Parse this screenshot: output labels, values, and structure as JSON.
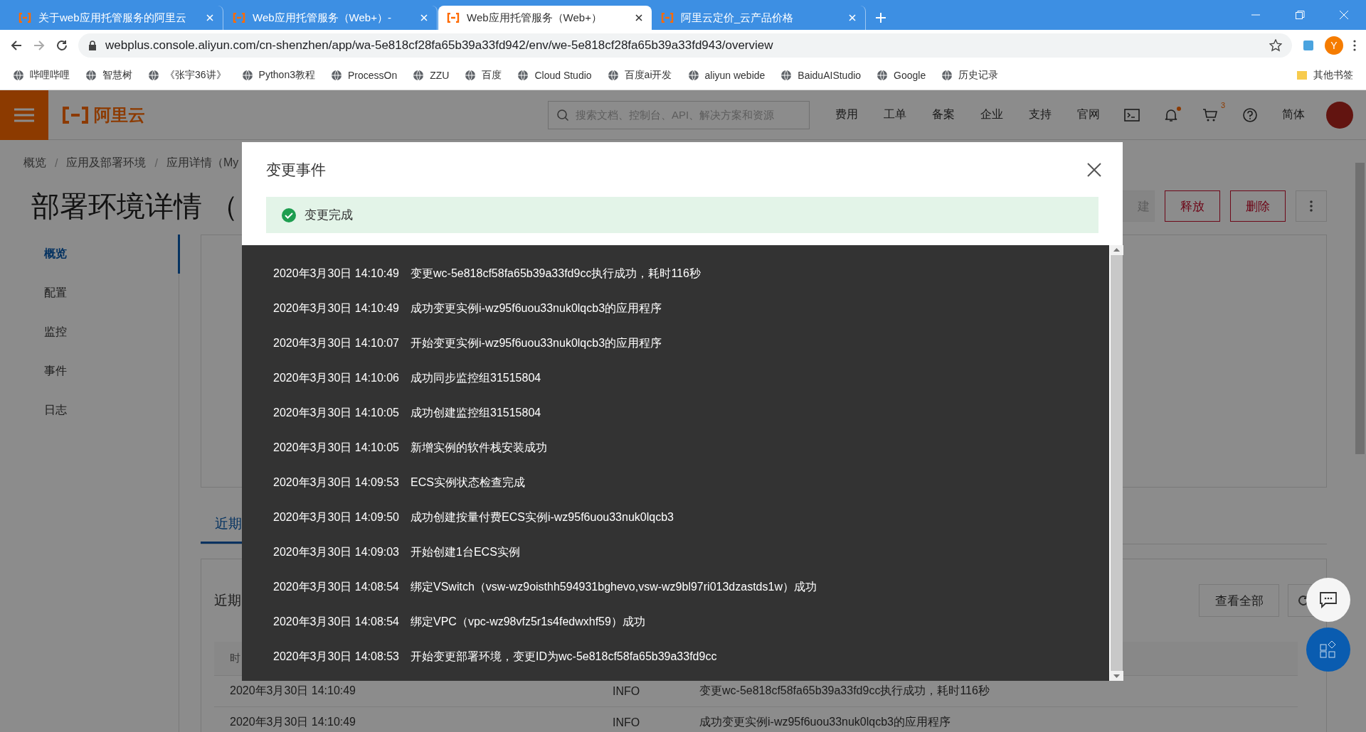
{
  "browser": {
    "tabs": [
      {
        "title": "关于web应用托管服务的阿里云",
        "selected": false
      },
      {
        "title": "Web应用托管服务（Web+）-",
        "selected": false
      },
      {
        "title": "Web应用托管服务（Web+）",
        "selected": true
      },
      {
        "title": "阿里云定价_云产品价格",
        "selected": false
      }
    ],
    "url": "webplus.console.aliyun.com/cn-shenzhen/app/wa-5e818cf28fa65b39a33fd942/env/we-5e818cf28fa65b39a33fd943/overview",
    "profile": "Y",
    "bookmarks": [
      "哔哩哔哩",
      "智慧树",
      "《张宇36讲》",
      "Python3教程",
      "ProcessOn",
      "ZZU",
      "百度",
      "Cloud Studio",
      "百度ai开发",
      "aliyun webide",
      "BaiduAIStudio",
      "Google",
      "历史记录"
    ],
    "other_bookmarks": "其他书签"
  },
  "header": {
    "logo": "阿里云",
    "search_placeholder": "搜索文档、控制台、API、解决方案和资源",
    "nav": [
      "费用",
      "工单",
      "备案",
      "企业",
      "支持",
      "官网"
    ],
    "cart_count": "3",
    "language": "简体"
  },
  "breadcrumb": [
    {
      "label": "概览"
    },
    {
      "separator": "/",
      "label": "应用及部署环境"
    },
    {
      "separator": "/",
      "label": "应用详情（My"
    }
  ],
  "page_title": "部署环境详情 （",
  "actions": [
    {
      "label": "建",
      "disabled": true
    },
    {
      "label": "释放",
      "disabled": false
    },
    {
      "label": "删除",
      "disabled": false
    }
  ],
  "side_nav": [
    {
      "label": "概览",
      "selected": true
    },
    {
      "label": "配置",
      "selected": false
    },
    {
      "label": "监控",
      "selected": false
    },
    {
      "label": "事件",
      "selected": false
    },
    {
      "label": "日志",
      "selected": false
    }
  ],
  "tab": "近期",
  "events_card": {
    "title": "近期",
    "column_1": "时",
    "view_all": "查看全部",
    "rows": [
      {
        "time": "2020年3月30日 14:10:49",
        "level": "INFO",
        "message": "变更wc-5e818cf58fa65b39a33fd9cc执行成功，耗时116秒"
      },
      {
        "time": "2020年3月30日 14:10:49",
        "level": "INFO",
        "message": "成功变更实例i-wz95f6uou33nuk0lqcb3的应用程序"
      }
    ]
  },
  "modal": {
    "title": "变更事件",
    "status": "变更完成",
    "log": [
      {
        "time": "2020年3月30日 14:10:49",
        "message": "变更wc-5e818cf58fa65b39a33fd9cc执行成功，耗时116秒"
      },
      {
        "time": "2020年3月30日 14:10:49",
        "message": "成功变更实例i-wz95f6uou33nuk0lqcb3的应用程序"
      },
      {
        "time": "2020年3月30日 14:10:07",
        "message": "开始变更实例i-wz95f6uou33nuk0lqcb3的应用程序"
      },
      {
        "time": "2020年3月30日 14:10:06",
        "message": "成功同步监控组31515804"
      },
      {
        "time": "2020年3月30日 14:10:05",
        "message": "成功创建监控组31515804"
      },
      {
        "time": "2020年3月30日 14:10:05",
        "message": "新增实例的软件栈安装成功"
      },
      {
        "time": "2020年3月30日 14:09:53",
        "message": "ECS实例状态检查完成"
      },
      {
        "time": "2020年3月30日 14:09:50",
        "message": "成功创建按量付费ECS实例i-wz95f6uou33nuk0lqcb3"
      },
      {
        "time": "2020年3月30日 14:09:03",
        "message": "开始创建1台ECS实例"
      },
      {
        "time": "2020年3月30日 14:08:54",
        "message": "绑定VSwitch（vsw-wz9oisthh594931bghevo,vsw-wz9bl97ri013dzastds1w）成功"
      },
      {
        "time": "2020年3月30日 14:08:54",
        "message": "绑定VPC（vpc-wz98vfz5r1s4fedwxhf59）成功"
      },
      {
        "time": "2020年3月30日 14:08:53",
        "message": "开始变更部署环境，变更ID为wc-5e818cf58fa65b39a33fd9cc"
      }
    ]
  }
}
